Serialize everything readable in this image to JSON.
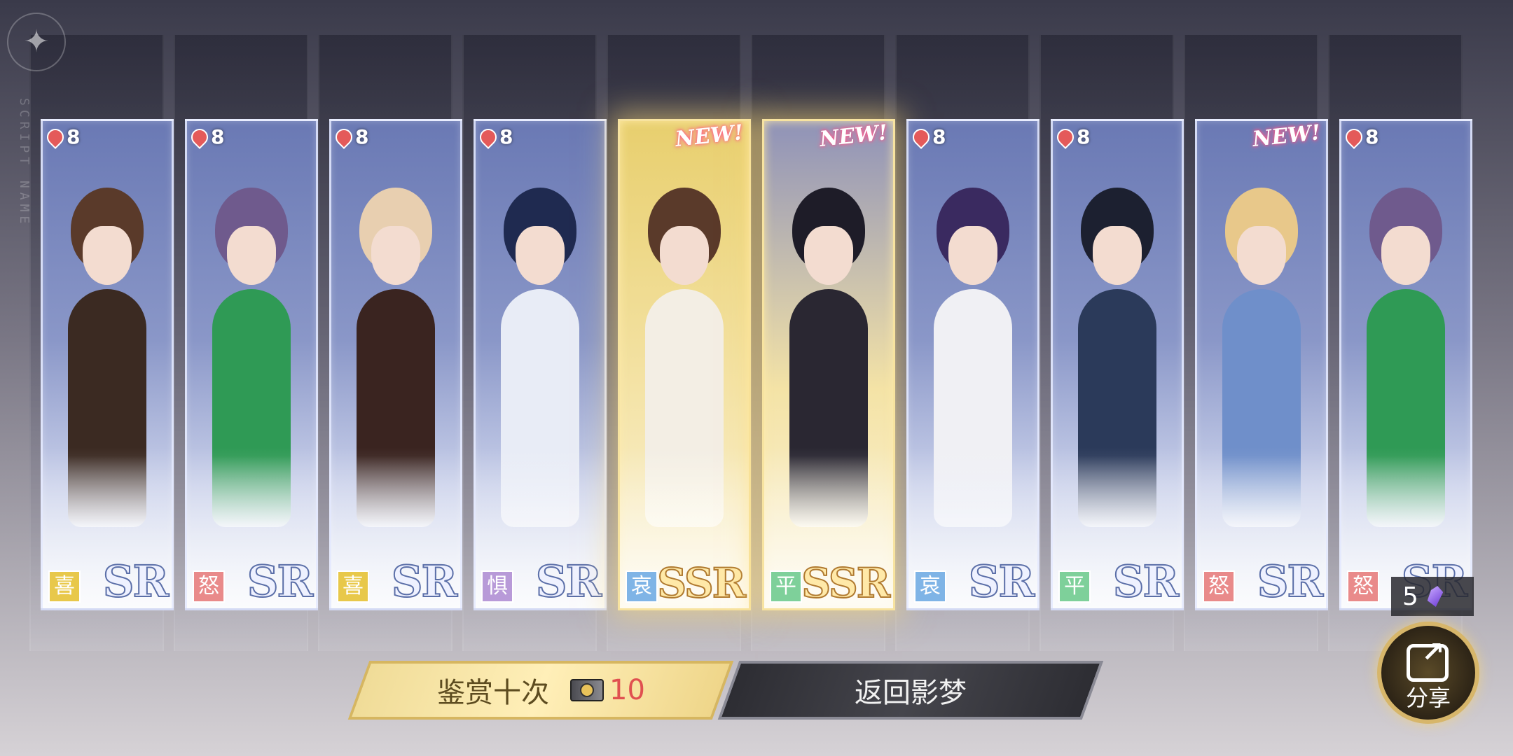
{
  "side_text": "SCRIPT NAME",
  "cards": [
    {
      "cost": "8",
      "mood": "喜",
      "rarity": "SR",
      "is_new": false,
      "new_label": "",
      "mood_color": "#e8c84a",
      "hair": "#5a3a2a",
      "outfit": "#3b2a22",
      "bg": "#6a79b4"
    },
    {
      "cost": "8",
      "mood": "怒",
      "rarity": "SR",
      "is_new": false,
      "new_label": "",
      "mood_color": "#e98a8a",
      "hair": "#6f5a8d",
      "outfit": "#2f9a55",
      "bg": "#6a79b4"
    },
    {
      "cost": "8",
      "mood": "喜",
      "rarity": "SR",
      "is_new": false,
      "new_label": "",
      "mood_color": "#e8c84a",
      "hair": "#e8cfb0",
      "outfit": "#3a2420",
      "bg": "#6a79b4"
    },
    {
      "cost": "8",
      "mood": "惧",
      "rarity": "SR",
      "is_new": false,
      "new_label": "",
      "mood_color": "#b89ad8",
      "hair": "#1f2a50",
      "outfit": "#e8ecf6",
      "bg": "#6a79b4"
    },
    {
      "cost": "",
      "mood": "哀",
      "rarity": "SSR",
      "is_new": true,
      "new_label": "NEW!",
      "mood_color": "#7fb4e6",
      "hair": "#5a3a2a",
      "outfit": "#f3eee4",
      "bg": "#e8cf6e"
    },
    {
      "cost": "",
      "mood": "平",
      "rarity": "SSR",
      "is_new": true,
      "new_label": "NEW!",
      "mood_color": "#7ed09a",
      "hair": "#1e1c28",
      "outfit": "#2a2732",
      "bg": "#8f92b8"
    },
    {
      "cost": "8",
      "mood": "哀",
      "rarity": "SR",
      "is_new": false,
      "new_label": "",
      "mood_color": "#7fb4e6",
      "hair": "#3a2a60",
      "outfit": "#f0f0f4",
      "bg": "#6a79b4"
    },
    {
      "cost": "8",
      "mood": "平",
      "rarity": "SR",
      "is_new": false,
      "new_label": "",
      "mood_color": "#7ed09a",
      "hair": "#1c2030",
      "outfit": "#2b3a5a",
      "bg": "#6a79b4"
    },
    {
      "cost": "",
      "mood": "怒",
      "rarity": "SR",
      "is_new": true,
      "new_label": "NEW!",
      "mood_color": "#e98a8a",
      "hair": "#e8c88a",
      "outfit": "#6f8fca",
      "bg": "#6a79b4"
    },
    {
      "cost": "8",
      "mood": "怒",
      "rarity": "SR",
      "is_new": false,
      "new_label": "",
      "mood_color": "#e98a8a",
      "hair": "#6f5a8d",
      "outfit": "#2f9a55",
      "bg": "#6a79b4"
    }
  ],
  "buttons": {
    "appreciate_label": "鉴赏十次",
    "ticket_count": "10",
    "return_label": "返回影梦"
  },
  "share": {
    "count": "5",
    "label": "分享"
  }
}
